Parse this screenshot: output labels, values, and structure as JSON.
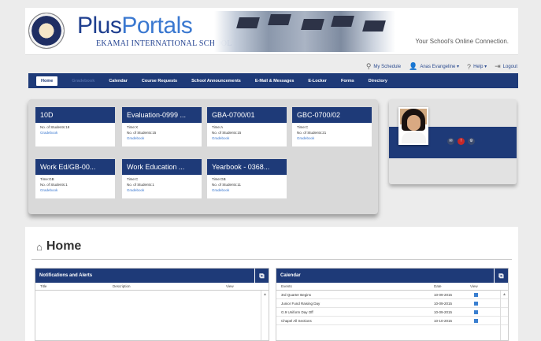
{
  "header": {
    "brand_plus": "Plus",
    "brand_portals": "Portals",
    "school_name": "EKAMAI INTERNATIONAL SCHOOL",
    "tagline": "Your School's Online Connection."
  },
  "userbar": {
    "schedule": "My Schedule",
    "user": "Anas Evangeline ▾",
    "help": "Help ▾",
    "logout": "Logout"
  },
  "nav": {
    "items": [
      "Home",
      "Gradebook",
      "Calendar",
      "Course Requests",
      "School Announcements",
      "E-Mail & Messages",
      "E-Locker",
      "Forms",
      "Directory"
    ]
  },
  "cards": [
    {
      "title": "10D",
      "line1": "No. of Students:18",
      "line2": "Gradebook",
      "line3": ""
    },
    {
      "title": "Evaluation-0999 ...",
      "line1": "Time:X",
      "line2": "No. of Students:15",
      "line3": "Gradebook"
    },
    {
      "title": "GBA-0700/01",
      "line1": "Time:A",
      "line2": "No. of Students:15",
      "line3": "Gradebook"
    },
    {
      "title": "GBC-0700/02",
      "line1": "Time:C",
      "line2": "No. of Students:21",
      "line3": "Gradebook"
    },
    {
      "title": "Work Ed/GB-00...",
      "line1": "Time:GB",
      "line2": "No. of Students:1",
      "line3": "Gradebook"
    },
    {
      "title": "Work Education ...",
      "line1": "Time:C",
      "line2": "No. of Students:1",
      "line3": "Gradebook"
    },
    {
      "title": "Yearbook - 0368...",
      "line1": "Time:GB",
      "line2": "No. of Students:11",
      "line3": "Gradebook"
    }
  ],
  "home": {
    "title": "Home"
  },
  "notifications": {
    "title": "Notifications and Alerts",
    "columns": [
      "Title",
      "Description",
      "View"
    ]
  },
  "calendar": {
    "title": "Calendar",
    "columns": [
      "Events",
      "Date",
      "View"
    ],
    "rows": [
      {
        "event": "3rd Quarter Begins",
        "date": "10-09-2015"
      },
      {
        "event": "Junior Fund Raising Day",
        "date": "10-09-2015"
      },
      {
        "event": "G.9 Uniform Day Off",
        "date": "10-09-2015"
      },
      {
        "event": "Chapel All Sections",
        "date": "10-10-2015"
      }
    ]
  },
  "colors": {
    "navy": "#1e3a78",
    "link": "#3a78d0"
  }
}
